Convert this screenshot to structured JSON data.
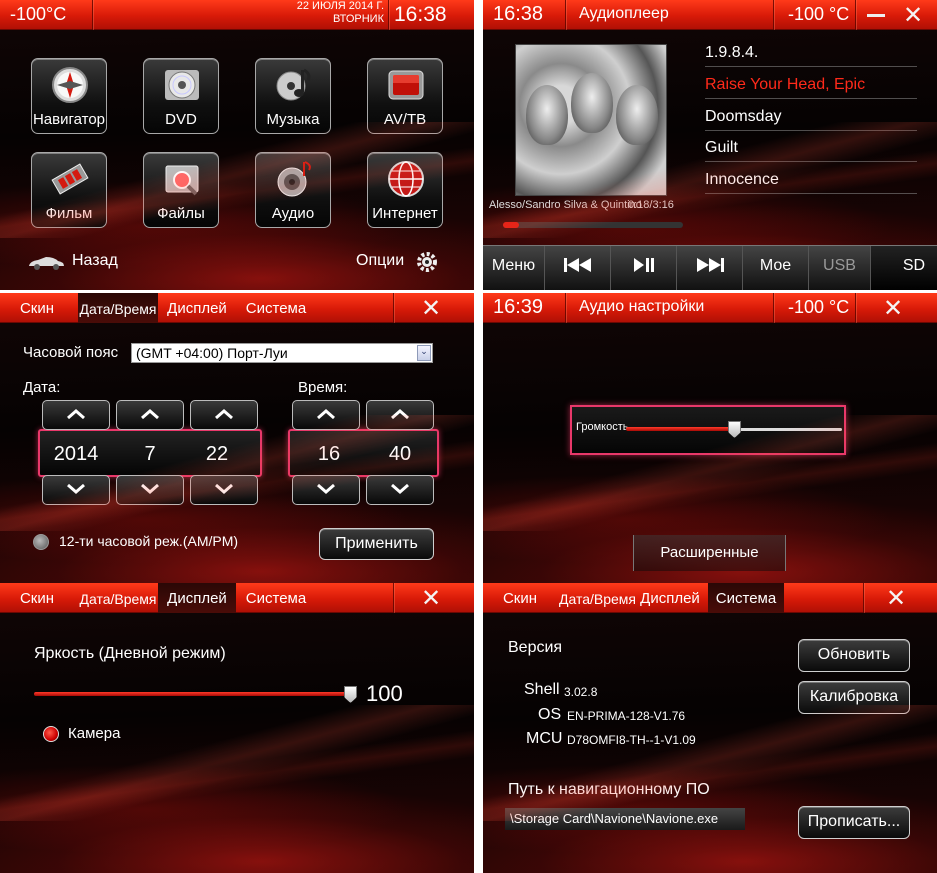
{
  "home": {
    "temperature": "-100°C",
    "date": "22 ИЮЛЯ 2014 Г.",
    "weekday": "ВТОРНИК",
    "time": "16:38",
    "tiles": [
      {
        "label": "Навигатор",
        "icon": "compass-icon"
      },
      {
        "label": "DVD",
        "icon": "disc-icon"
      },
      {
        "label": "Музыка",
        "icon": "music-note-icon"
      },
      {
        "label": "AV/TB",
        "icon": "tv-icon"
      },
      {
        "label": "Фильм",
        "icon": "film-icon"
      },
      {
        "label": "Файлы",
        "icon": "folder-icon"
      },
      {
        "label": "Аудио",
        "icon": "speaker-icon"
      },
      {
        "label": "Интернет",
        "icon": "globe-icon"
      }
    ],
    "back_label": "Назад",
    "options_label": "Опции"
  },
  "player": {
    "time": "16:38",
    "title": "Аудиоплеер",
    "temperature": "-100 °C",
    "tracks": [
      "1.9.8.4.",
      "Raise Your Head, Epic",
      "Doomsday",
      "Guilt",
      "Innocence"
    ],
    "current_index": 1,
    "artist": "Alesso/Sandro Silva & Quintino",
    "position": "0:18/3:16",
    "progress": 0.09,
    "controls": {
      "menu": "Меню",
      "prev": "prev-icon",
      "play_pause": "play-pause-icon",
      "next": "next-icon",
      "my": "Мое",
      "usb": "USB",
      "sd": "SD"
    }
  },
  "datetime": {
    "tabs": [
      "Скин",
      "Дата/Время",
      "Дисплей",
      "Система"
    ],
    "active_tab": 1,
    "timezone_label": "Часовой пояс",
    "timezone_value": "(GMT +04:00) Порт-Луи",
    "date_label": "Дата:",
    "time_label": "Время:",
    "year": "2014",
    "month": "7",
    "day": "22",
    "hour": "16",
    "minute": "40",
    "ampm_label": "12-ти часовой реж.(AM/PM)",
    "apply_label": "Применить"
  },
  "audio": {
    "time": "16:39",
    "title": "Аудио настройки",
    "temperature": "-100 °C",
    "volume_label": "Громкость",
    "volume_level": 0.5,
    "advanced_label": "Расширенные"
  },
  "display": {
    "tabs": [
      "Скин",
      "Дата/Время",
      "Дисплей",
      "Система"
    ],
    "active_tab": 2,
    "brightness_label": "Яркость (Дневной режим)",
    "brightness_value": "100",
    "camera_label": "Камера"
  },
  "system": {
    "tabs": [
      "Скин",
      "Дата/Время",
      "Дисплей",
      "Система"
    ],
    "active_tab": 3,
    "version_label": "Версия",
    "shell_label": "Shell",
    "shell_value": "3.02.8",
    "os_label": "OS",
    "os_value": "EN-PRIMA-128-V1.76",
    "mcu_label": "MCU",
    "mcu_value": "D78OMFI8-TH--1-V1.09",
    "update_label": "Обновить",
    "calibrate_label": "Калибровка",
    "nav_path_label": "Путь к навигационному ПО",
    "nav_path_value": "\\Storage Card\\Navione\\Navione.exe",
    "set_label": "Прописать..."
  },
  "colors": {
    "accent": "#e01a10",
    "current_track": "#ff2a1a",
    "highlight_border": "#e8386a"
  }
}
